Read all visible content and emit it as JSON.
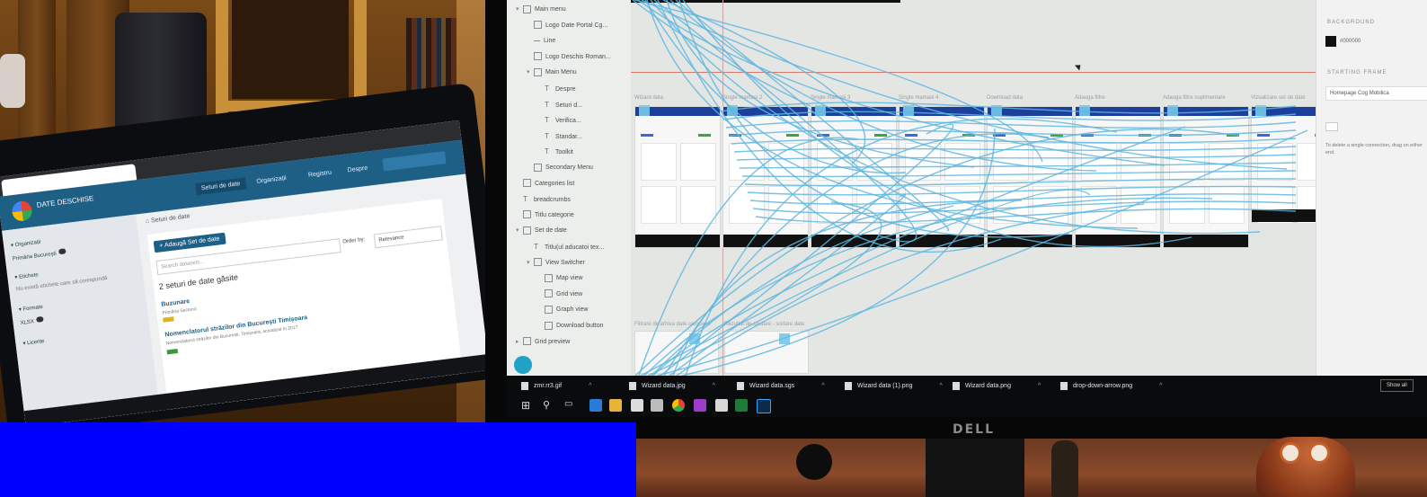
{
  "laptop": {
    "app_name": "DATE DESCHISE",
    "nav": [
      "Seturi de date",
      "Organizații",
      "Registru",
      "Despre"
    ],
    "breadcrumb": "Seturi de date",
    "sidebar": [
      {
        "label": "▾ Organizații",
        "badge": false
      },
      {
        "label": "Primăria Bucureşti",
        "badge": true
      },
      {
        "label": "▾ Etichete",
        "badge": false
      },
      {
        "label": "Nu există etichete care să corespundă",
        "badge": false
      },
      {
        "label": "▾ Formate",
        "badge": false
      },
      {
        "label": "XLSX",
        "badge": true
      },
      {
        "label": "▾ Licențe",
        "badge": false
      }
    ],
    "add_button": "+ Adaugă Set de date",
    "search_placeholder": "Search datasets...",
    "sort_label": "Order by:",
    "sort_value": "Relevance",
    "result_count": "2 seturi de date găsite",
    "results": [
      {
        "title": "Buzunare",
        "org": "Primăria Sectorul",
        "tag": "XLSX"
      },
      {
        "title": "Nomenclatorul străzilor din București Timișoara",
        "org": "Nomenclatorul străzilor din București, Timișoara, actualizat în 2017",
        "tag": "XLSX"
      }
    ]
  },
  "monitor": {
    "layers": [
      {
        "label": "Main menu",
        "indent": 0,
        "type": "group",
        "caret": "▾"
      },
      {
        "label": "Logo Date Portal Cg...",
        "indent": 1,
        "type": "box",
        "caret": ""
      },
      {
        "label": "Line",
        "indent": 1,
        "type": "line",
        "caret": ""
      },
      {
        "label": "Logo Deschis Roman...",
        "indent": 1,
        "type": "box",
        "caret": ""
      },
      {
        "label": "Main Menu",
        "indent": 1,
        "type": "group",
        "caret": "▾"
      },
      {
        "label": "Despre",
        "indent": 2,
        "type": "text",
        "caret": ""
      },
      {
        "label": "Seturi d...",
        "indent": 2,
        "type": "text",
        "caret": ""
      },
      {
        "label": "Verifica...",
        "indent": 2,
        "type": "text",
        "caret": ""
      },
      {
        "label": "Standar...",
        "indent": 2,
        "type": "text",
        "caret": ""
      },
      {
        "label": "Toolkit",
        "indent": 2,
        "type": "text",
        "caret": ""
      },
      {
        "label": "Secondary Menu",
        "indent": 1,
        "type": "box",
        "caret": ""
      },
      {
        "label": "Categories list",
        "indent": 0,
        "type": "box",
        "caret": ""
      },
      {
        "label": "breadcrumbs",
        "indent": 0,
        "type": "text",
        "caret": ""
      },
      {
        "label": "Titlu categorie",
        "indent": 0,
        "type": "box",
        "caret": ""
      },
      {
        "label": "Set de date",
        "indent": 0,
        "type": "group",
        "caret": "▾"
      },
      {
        "label": "Titlu(ul aducatoi tex...",
        "indent": 1,
        "type": "text",
        "caret": ""
      },
      {
        "label": "View Switcher",
        "indent": 1,
        "type": "group",
        "caret": "▾"
      },
      {
        "label": "Map view",
        "indent": 2,
        "type": "box",
        "caret": ""
      },
      {
        "label": "Grid view",
        "indent": 2,
        "type": "box",
        "caret": ""
      },
      {
        "label": "Graph view",
        "indent": 2,
        "type": "box",
        "caret": ""
      },
      {
        "label": "Download button",
        "indent": 2,
        "type": "box",
        "caret": ""
      },
      {
        "label": "Grid preview",
        "indent": 0,
        "type": "group",
        "caret": "▸"
      }
    ],
    "frame_titles": [
      "Wizard data",
      "Single mamasi 2",
      "Single mamasi 3",
      "Single mamasi 4",
      "Download data",
      "Adauga filtre",
      "Adauga filtre suplimentare",
      "Vizualizare set de date"
    ],
    "bottom_frame_titles": [
      "Filtrare de arhiva date campanii",
      "Rezultat de cautare - sortare date"
    ],
    "properties": {
      "background_label": "BACKGROUND",
      "background_value": "#000000",
      "starting_frame_label": "STARTING FRAME",
      "starting_frame_value": "Homepage Cog Mobilica",
      "hint": "To delete a single connection, drag on either end."
    },
    "downloads": [
      {
        "name": "zmr.rr3.gif"
      },
      {
        "name": "Wizard data.jpg"
      },
      {
        "name": "Wizard data.sgs"
      },
      {
        "name": "Wizard data (1).png"
      },
      {
        "name": "Wizard data.png"
      },
      {
        "name": "drop-down-arrow.png"
      }
    ],
    "show_all": "Show all",
    "brand": "DELL"
  },
  "colors": {
    "laptop_header": "#1e5f86",
    "frame_header": "#1b3f9a",
    "wire": "#5fb6df",
    "redaction": "#0000ff"
  }
}
